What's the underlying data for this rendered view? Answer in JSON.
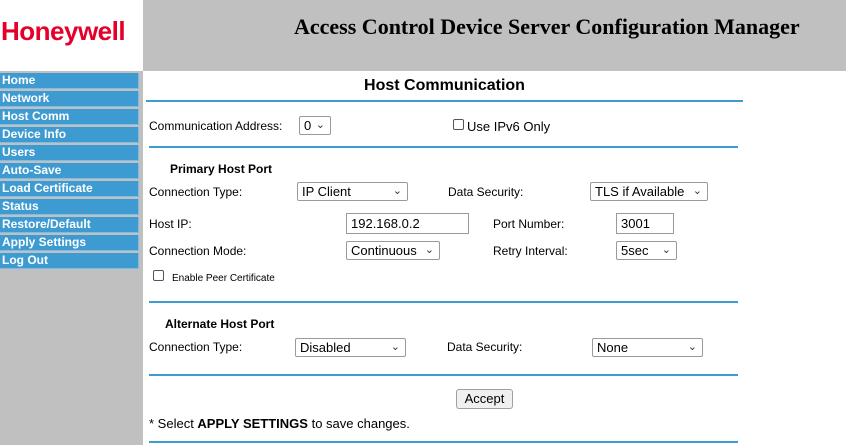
{
  "header": {
    "logo_text": "Honeywell",
    "title": "Access Control Device Server Configuration Manager"
  },
  "sidebar": {
    "items": [
      {
        "label": "Home"
      },
      {
        "label": "Network"
      },
      {
        "label": "Host Comm"
      },
      {
        "label": "Device Info"
      },
      {
        "label": "Users"
      },
      {
        "label": "Auto-Save"
      },
      {
        "label": "Load Certificate"
      },
      {
        "label": "Status"
      },
      {
        "label": "Restore/Default"
      },
      {
        "label": "Apply Settings"
      },
      {
        "label": "Log Out"
      }
    ]
  },
  "main": {
    "page_title": "Host Communication",
    "comm_address": {
      "label": "Communication Address:",
      "value": "0"
    },
    "ipv6": {
      "label": "Use IPv6 Only",
      "checked": false
    },
    "primary": {
      "heading": "Primary Host Port",
      "connection_type": {
        "label": "Connection Type:",
        "value": "IP Client"
      },
      "data_security": {
        "label": "Data Security:",
        "value": "TLS if Available"
      },
      "host_ip": {
        "label": "Host IP:",
        "value": "192.168.0.2"
      },
      "port_number": {
        "label": "Port Number:",
        "value": "3001"
      },
      "connection_mode": {
        "label": "Connection Mode:",
        "value": "Continuous"
      },
      "retry_interval": {
        "label": "Retry Interval:",
        "value": "5sec"
      },
      "peer_certificate": {
        "label": "Enable Peer Certificate",
        "checked": false
      }
    },
    "alternate": {
      "heading": "Alternate Host Port",
      "connection_type": {
        "label": "Connection Type:",
        "value": "Disabled"
      },
      "data_security": {
        "label": "Data Security:",
        "value": "None"
      }
    },
    "accept_label": "Accept",
    "note": {
      "prefix": "* Select ",
      "emphasis": "APPLY SETTINGS",
      "suffix": " to save changes."
    }
  },
  "colors": {
    "brand_red": "#e4002b",
    "nav_blue": "#3d9bd2",
    "header_gray": "#c0c0c0"
  },
  "icons": {
    "dropdown": "chevron-down-icon"
  }
}
